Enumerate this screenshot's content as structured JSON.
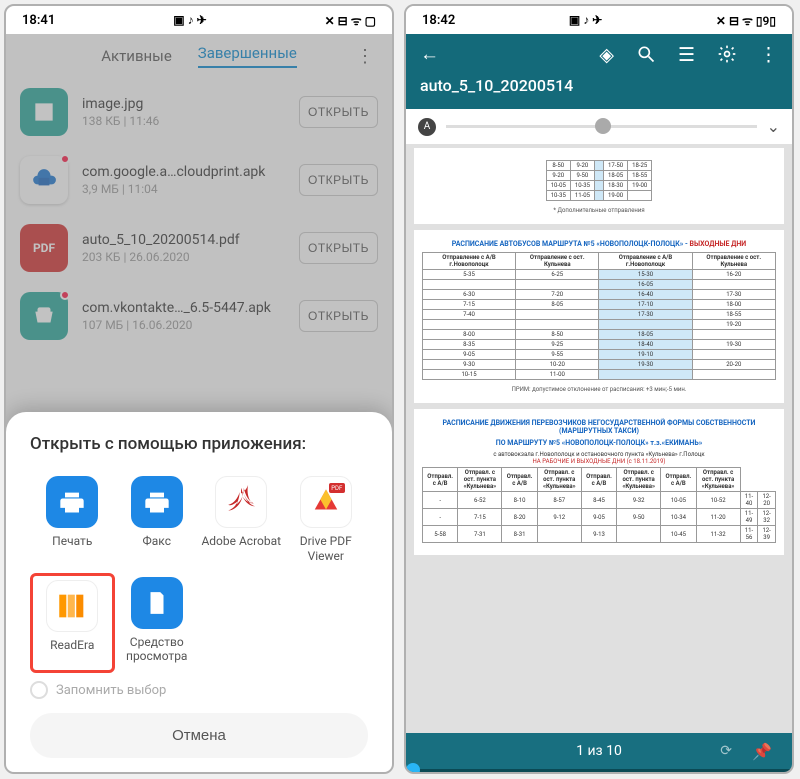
{
  "left": {
    "status": {
      "time": "18:41"
    },
    "tabs": {
      "active": "Активные",
      "finished": "Завершенные"
    },
    "files": [
      {
        "icon": "image",
        "name": "image.jpg",
        "meta": "138 КБ | 11:46",
        "btn": "ОТКРЫТЬ",
        "badge": false
      },
      {
        "icon": "cloudprint",
        "name": "com.google.a…cloudprint.apk",
        "meta": "3,9 МБ | 11:04",
        "btn": "ОТКРЫТЬ",
        "badge": true
      },
      {
        "icon": "pdf",
        "name": "auto_5_10_20200514.pdf",
        "meta": "203 КБ | 26.06.2020",
        "btn": "ОТКРЫТЬ",
        "badge": false
      },
      {
        "icon": "apk",
        "name": "com.vkontakte…_6.5-5447.apk",
        "meta": "107 МБ | 16.06.2020",
        "btn": "ОТКРЫТЬ",
        "badge": true
      }
    ],
    "sheet": {
      "title": "Открыть с помощью приложения:",
      "apps": [
        {
          "id": "print",
          "label": "Печать"
        },
        {
          "id": "fax",
          "label": "Факс"
        },
        {
          "id": "acrobat",
          "label": "Adobe Acrobat"
        },
        {
          "id": "drive",
          "label": "Drive PDF Viewer"
        },
        {
          "id": "readera",
          "label": "ReadEra",
          "highlight": true
        },
        {
          "id": "viewer",
          "label": "Средство просмотра"
        }
      ],
      "remember": "Запомнить выбор",
      "cancel": "Отмена"
    }
  },
  "right": {
    "status": {
      "time": "18:42"
    },
    "doc_title": "auto_5_10_20200514",
    "pager": "1 из 10",
    "page1": {
      "rows": [
        [
          "8-50",
          "9-20",
          "",
          "17-50",
          "18-25"
        ],
        [
          "9-20",
          "9-50",
          "",
          "18-05",
          "18-55"
        ],
        [
          "10-05",
          "10-35",
          "",
          "18-30",
          "19-00"
        ],
        [
          "10-35",
          "11-05",
          "",
          "19-00",
          ""
        ]
      ],
      "foot": "* Дополнительные отправления"
    },
    "page2": {
      "title": "РАСПИСАНИЕ АВТОБУСОВ МАРШРУТА №5 «НОВОПОЛОЦК-ПОЛОЦК» - ",
      "title_red": "ВЫХОДНЫЕ ДНИ",
      "head": [
        "Отправление с А/В г.Новополоцк",
        "Отправление с ост. Кульнева",
        "Отправление с А/В г.Новополоцк",
        "Отправление с ост. Кульнева"
      ],
      "rows": [
        [
          "5-35",
          "6-25",
          "15-30",
          "16-20"
        ],
        [
          "",
          "",
          "16-05",
          ""
        ],
        [
          "6-30",
          "7-20",
          "16-40",
          "17-30"
        ],
        [
          "7-15",
          "8-05",
          "17-10",
          "18-00"
        ],
        [
          "7-40",
          "",
          "17-30",
          "18-55"
        ],
        [
          "",
          "",
          "",
          "19-20"
        ],
        [
          "8-00",
          "8-50",
          "18-05",
          ""
        ],
        [
          "8-35",
          "9-25",
          "18-40",
          "19-30"
        ],
        [
          "9-05",
          "9-55",
          "19-10",
          ""
        ],
        [
          "9-30",
          "10-20",
          "19-30",
          "20-20"
        ],
        [
          "10-15",
          "11-00",
          "",
          ""
        ]
      ],
      "foot": "ПРИМ: допустимое отклонение от расписания: +3 мин;-5 мин."
    },
    "page3": {
      "title": "РАСПИСАНИЕ ДВИЖЕНИЯ ПЕРЕВОЗЧИКОВ НЕГОСУДАРСТВЕННОЙ ФОРМЫ СОБСТВЕННОСТИ (МАРШРУТНЫХ ТАКСИ)",
      "sub1": "ПО МАРШРУТУ №5 «НОВОПОЛОЦК-ПОЛОЦК» т.з.«ЕКИМАНЬ»",
      "sub2": "с автовокзала г.Новополоцк и остановочного пункта «Кульнева» г.Полоцк",
      "sub3": "НА РАБОЧИЕ И ВЫХОДНЫЕ ДНИ (с 18.11.2019)",
      "head": [
        "Отправл. с А/В",
        "Отправл. с ост. пункта «Кульнева»",
        "Отправл. с А/В",
        "Отправл. с ост. пункта «Кульнева»",
        "Отправл. с А/В",
        "Отправл. с ост. пункта «Кульнева»",
        "Отправл. с А/В",
        "Отправл. с ост. пункта «Кульнева»"
      ],
      "rows": [
        [
          "-",
          "6-52",
          "8-10",
          "8-57",
          "8-45",
          "9-32",
          "10-05",
          "10-52",
          "11-40",
          "12-20"
        ],
        [
          "-",
          "7-15",
          "8-20",
          "9-12",
          "9-05",
          "9-50",
          "10-34",
          "11-20",
          "11-49",
          "12-32"
        ],
        [
          "5-58",
          "7-31",
          "8-31",
          "",
          "9-13",
          "",
          "10-45",
          "11-32",
          "11-56",
          "12-39"
        ]
      ]
    }
  }
}
